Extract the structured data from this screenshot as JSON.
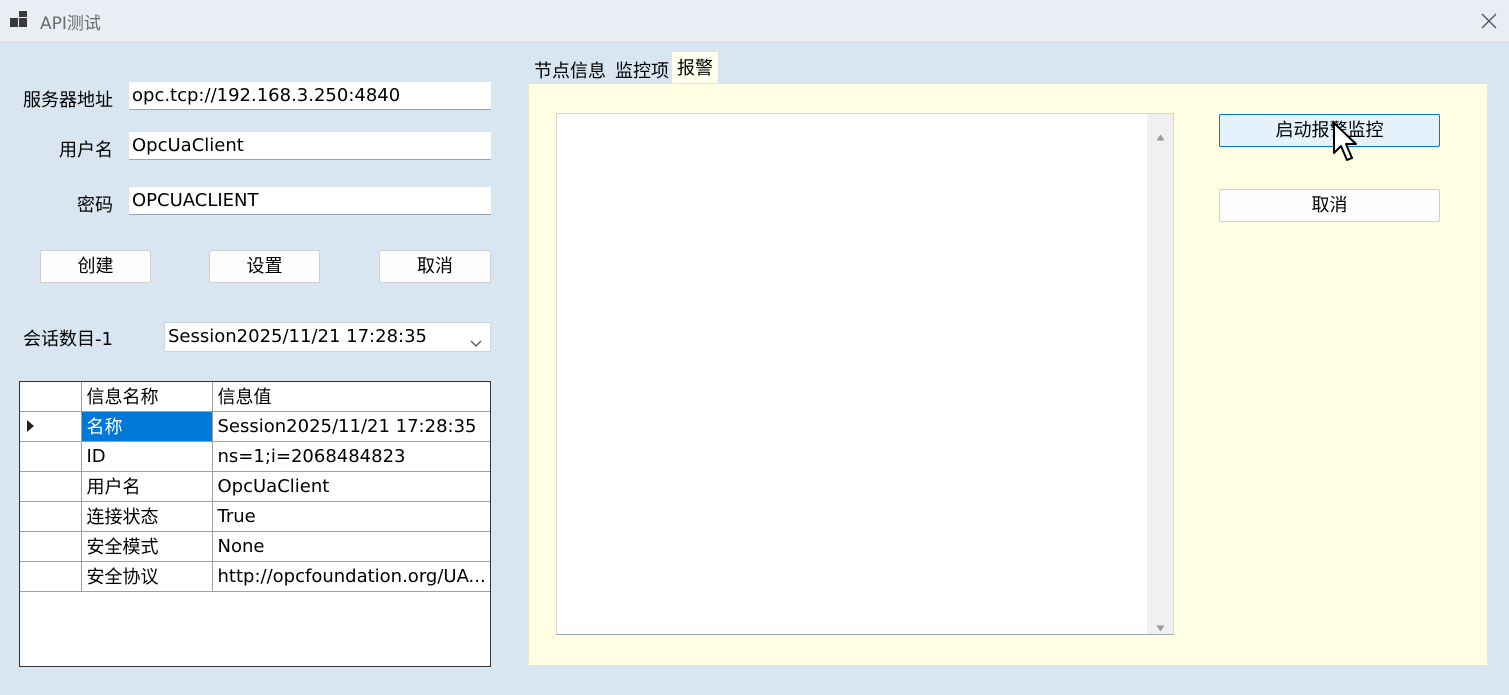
{
  "window": {
    "title": "API测试"
  },
  "form": {
    "server_label": "服务器地址",
    "server_value": "opc.tcp://192.168.3.250:4840",
    "user_label": "用户名",
    "user_value": "OpcUaClient",
    "password_label": "密码",
    "password_value": "OPCUACLIENT"
  },
  "buttons": {
    "create": "创建",
    "settings": "设置",
    "cancel": "取消"
  },
  "session": {
    "count_label": "会话数目-1",
    "selected": "Session2025/11/21 17:28:35"
  },
  "grid": {
    "headers": [
      "信息名称",
      "信息值"
    ],
    "rows": [
      {
        "name": "名称",
        "value": "Session2025/11/21 17:28:35"
      },
      {
        "name": "ID",
        "value": "ns=1;i=2068484823"
      },
      {
        "name": "用户名",
        "value": "OpcUaClient"
      },
      {
        "name": "连接状态",
        "value": "True"
      },
      {
        "name": "安全模式",
        "value": "None"
      },
      {
        "name": "安全协议",
        "value": "http://opcfoundation.org/UA..."
      }
    ]
  },
  "tabs": [
    "节点信息",
    "监控项",
    "报警"
  ],
  "alarm": {
    "start_button": "启动报警监控",
    "cancel_button": "取消"
  },
  "colors": {
    "selection": "#0078d7",
    "panel": "#ffffe3",
    "window": "#d9e6f2"
  }
}
